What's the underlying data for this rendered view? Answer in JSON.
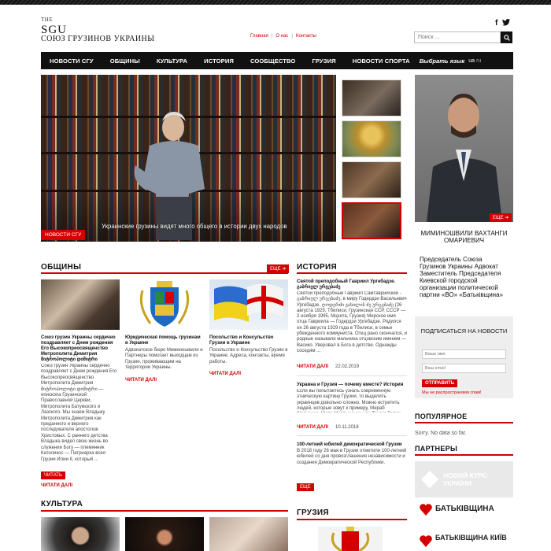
{
  "header": {
    "logo_the": "THE",
    "logo_sgu": "SGU",
    "logo_sub": "СОЮЗ ГРУЗИНОВ УКРАИНЫ",
    "toplinks": [
      "Главная",
      "О нас",
      "Контакты"
    ],
    "search_placeholder": "Поиск ..."
  },
  "nav": {
    "items": [
      "НОВОСТИ СГУ",
      "ОБЩИНЫ",
      "КУЛЬТУРА",
      "ИСТОРИЯ",
      "СООБЩЕСТВО",
      "ГРУЗИЯ",
      "НОВОСТИ СПОРТА"
    ],
    "lang_label": "Выбрать язык",
    "lang_ua": "ua",
    "lang_ru": "ru"
  },
  "hero": {
    "caption": "Украинские грузины видят много общего в истории двух народов",
    "tag": "НОВОСТИ СГУ"
  },
  "person": {
    "more": "ЕЩЕ",
    "name": "МИМИНОШВИЛИ ВАХТАНГИ ОМАРИЕВИЧ",
    "desc": "Председатель Союза Грузинов Украины Адвокат Заместитель Председателя Киевской городской организации политической партии «ВО» «Батьківщина»"
  },
  "obshchiny": {
    "title": "ОБЩИНЫ",
    "more": "ЕЩЕ",
    "cards": [
      {
        "title": "Союз грузин Украины сердечно поздравляет с Днем рождения Его Высокопреосвященство Митрополита Димитрия მიტროპოლიტი დიმიტრი",
        "text": "Союз грузин Украины сердечно поздравляет с Днем рождения Его Высокопреосвященство Митрополита Димитрия მიტროპოლიტი დიმიტრი — епископа Грузинской Православной Церкви, Митрополита Батумского и Лазского. Мы знаем Владыку Митрополита Димитрия как преданного и верного последователя апостолов Христовых. С раннего детства Владыка видел свою жизнь во служении Богу — племянник Католикос — Патриарха всея Грузии Илии II, который ...",
        "button": "ЧИТАТЬ"
      },
      {
        "title": "Юридическая помощь грузинам в Украине",
        "text": "Адвокатское бюро Миминошвили и Партнеры помогает выходцам из Грузии, проживающим на территории Украины.",
        "link": "ЧИТАТИ ДАЛІ"
      },
      {
        "title": "Посольство и Консульство Грузии в Украине",
        "text": "Посольство и Консульство Грузии в Украине. Адреса, контакты, время работы.",
        "link": "ЧИТАТИ ДАЛІ"
      }
    ],
    "bottom_link": "ЧИТАТИ ДАЛІ"
  },
  "history": {
    "title": "ИСТОРИЯ",
    "items": [
      {
        "title": "Святой преподобный Гавриил Ургебадзе. გაბრიელ ურგებაძე",
        "text": "Святой преподобный Гавриил Самтаврийский - გაბრიელ ურგებაძე, в миру Годердзи Васильевич Ургебадзе, ღოდერძი ვასილის ძე ურგებაძე (26 августа 1929, Тбилиси, Грузинская ССР, СССР — 2 ноября 1995, Мцхета, Грузия) Мирское имя отца Гавриила — Годердзи Ургебадзе. Родился он 26 августа 1929 года в Тбилиси, в семье убежденного коммуниста. Отец рано скончался, и родные называли мальчика отцовским именем — Васико. Уверовал в Бога в детстве. Однажды соседям ...",
        "link": "ЧИТАТИ ДАЛІ",
        "date": "22.02.2019"
      },
      {
        "title": "Украина и Грузия — почему вместе? История",
        "text": "Если вы попытаетесь узнать современную этническую картину Грузии, то выделить украинцев довольно сложно. Можно встретить людей, которые зовут к примеру, Мераб Шевченко, Шота Мартыненко или Тенгиз Гогаль...",
        "link": "ЧИТАТИ ДАЛІ",
        "date": "10.11.2018"
      },
      {
        "title": "100-летний юбилей демократической Грузии",
        "text": "В 2018 году 26 мая в Грузии отметили 100-летний юбилей со дня провозглашения независимости и создания Демократической Республики.",
        "button": "ЕЩЕ"
      }
    ]
  },
  "subscribe": {
    "title": "ПОДПИСАТЬСЯ НА НОВОСТИ",
    "name_placeholder": "Ваше имя",
    "email_placeholder": "Ваш email",
    "button": "ОТПРАВИТЬ",
    "note": "Мы не распространяем спам!"
  },
  "popular": {
    "title": "ПОПУЛЯРНОЕ",
    "empty": "Sorry. No data so far."
  },
  "partners": {
    "title": "ПАРТНЕРЫ",
    "items": [
      "НОВИЙ КУРС УКРАЇНИ",
      "БАТЬКІВЩИНА",
      "БАТЬКІВЩИНА КИЇВ"
    ]
  },
  "kultura": {
    "title": "КУЛЬТУРА"
  },
  "gruziya": {
    "title": "ГРУЗИЯ"
  },
  "colors": {
    "accent": "#d40000",
    "nav_bg": "#111111"
  }
}
